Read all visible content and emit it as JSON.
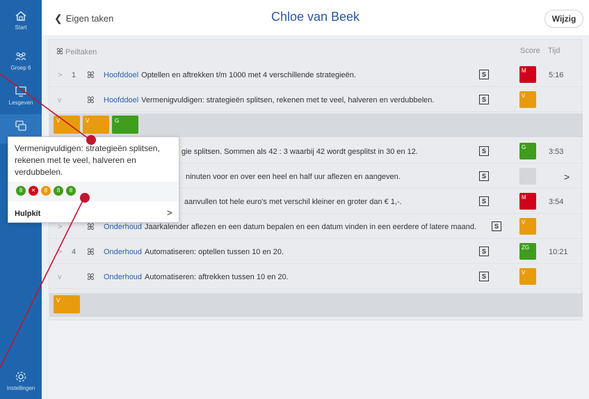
{
  "sidebar": {
    "items": [
      {
        "label": "Start",
        "icon": "home-icon"
      },
      {
        "label": "Groep 6",
        "icon": "group-icon"
      },
      {
        "label": "Lesgeven",
        "icon": "teach-icon"
      },
      {
        "label": "",
        "icon": "chat-icon"
      },
      {
        "label": "Instellingen",
        "icon": "gear-icon"
      }
    ]
  },
  "header": {
    "back_label": "Eigen taken",
    "title": "Chloe van Beek",
    "edit_label": "Wijzig"
  },
  "table": {
    "section_label": "Peiltaken",
    "score_header": "Score",
    "time_header": "Tijd",
    "rows": [
      {
        "expand": ">",
        "num": "1",
        "category": "Hoofddoel",
        "text": "Optellen en aftrekken t/m 1000 met 4 verschillende strategieën.",
        "s": "S",
        "score": "M",
        "score_color": "#d0021b",
        "time": "5:16"
      },
      {
        "expand": "v",
        "num": "",
        "category": "Hoofddoel",
        "text": "Vermenigvuldigen: strategieën splitsen, rekenen met te veel, halveren en verdubbelen.",
        "s": "S",
        "score": "V",
        "score_color": "#e89b0c",
        "time": ""
      },
      {
        "expand": "",
        "num": "",
        "category": "",
        "text": "gie splitsen. Sommen als 42 : 3 waarbij 42 wordt gesplitst in 30 en 12.",
        "s": "S",
        "score": "G",
        "score_color": "#3f9d1c",
        "time": "3:53"
      },
      {
        "expand": "",
        "num": "",
        "category": "",
        "text": "ninuten voor en over een heel en half uur aflezen en aangeven.",
        "s": "S",
        "score": "",
        "score_color": "#d3d6db",
        "time": "",
        "chevron": ">"
      },
      {
        "expand": "",
        "num": "",
        "category": "",
        "text": "aanvullen tot hele euro's met verschil kleiner en groter dan € 1,-.",
        "s": "S",
        "score": "M",
        "score_color": "#d0021b",
        "time": "3:54"
      },
      {
        "expand": ">",
        "num": "",
        "category": "Onderhoud",
        "text": "Jaarkalender aflezen en een datum bepalen en een datum vinden in een eerdere of latere maand.",
        "s": "S",
        "score": "V",
        "score_color": "#e89b0c",
        "time": ""
      },
      {
        "expand": ">",
        "num": "4",
        "category": "Onderhoud",
        "text": "Automatiseren: optellen tussen 10 en 20.",
        "s": "S",
        "score": "ZG",
        "score_color": "#3f9d1c",
        "time": "10:21"
      },
      {
        "expand": "v",
        "num": "",
        "category": "Onderhoud",
        "text": "Automatiseren: aftrekken tussen 10 en 20.",
        "s": "S",
        "score": "V",
        "score_color": "#e89b0c",
        "time": ""
      }
    ],
    "tagrow1": [
      {
        "label": "V",
        "color": "#e89b0c"
      },
      {
        "label": "V",
        "color": "#e89b0c"
      },
      {
        "label": "G",
        "color": "#3f9d1c"
      }
    ],
    "tagrow2": [
      {
        "label": "V",
        "color": "#e89b0c"
      }
    ]
  },
  "popup": {
    "text": "Vermenigvuldigen: strategieën splitsen, rekenen met te veel, halveren en verdubbelen.",
    "dots": [
      {
        "symbol": "8",
        "color": "#3f9d1c"
      },
      {
        "symbol": "✕",
        "color": "#d0021b"
      },
      {
        "symbol": "8",
        "color": "#e89b0c"
      },
      {
        "symbol": "8",
        "color": "#3f9d1c"
      },
      {
        "symbol": "8",
        "color": "#3f9d1c"
      }
    ],
    "link_label": "Hulpkit",
    "link_chevron": ">"
  },
  "annotation_color": "#c0152f"
}
